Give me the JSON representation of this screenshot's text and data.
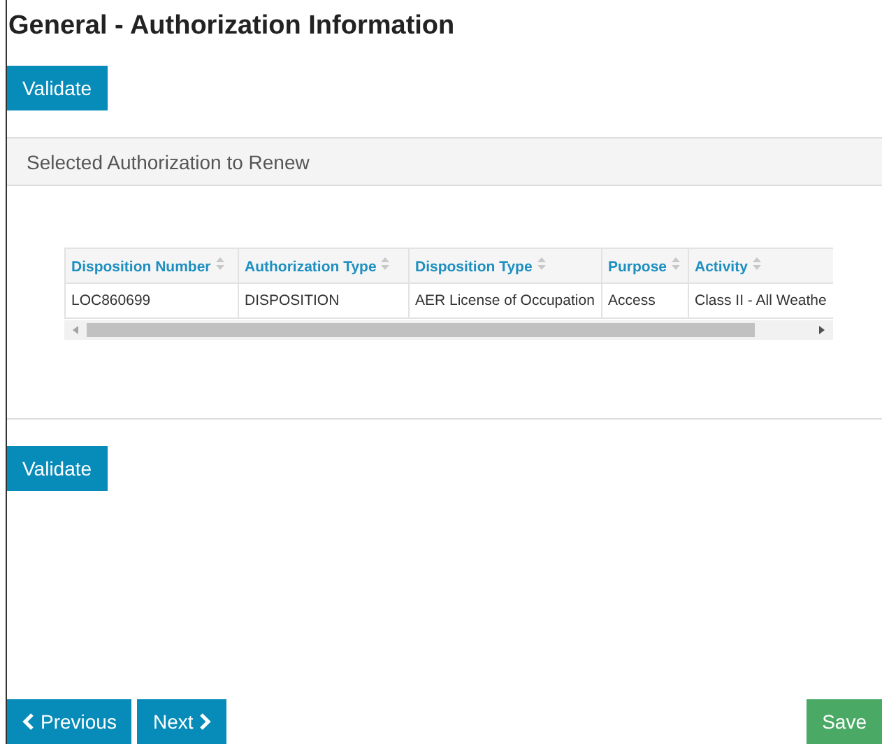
{
  "title": "General - Authorization Information",
  "validate_top": "Validate",
  "panel": {
    "heading": "Selected Authorization to Renew",
    "table": {
      "columns": [
        "Disposition Number",
        "Authorization Type",
        "Disposition Type",
        "Purpose",
        "Activity"
      ],
      "rows": [
        [
          "LOC860699",
          "DISPOSITION",
          "AER License of Occupation",
          "Access",
          "Class II - All Weathe"
        ]
      ]
    }
  },
  "validate_bottom": "Validate",
  "footer": {
    "previous": "Previous",
    "next": "Next",
    "save": "Save"
  }
}
